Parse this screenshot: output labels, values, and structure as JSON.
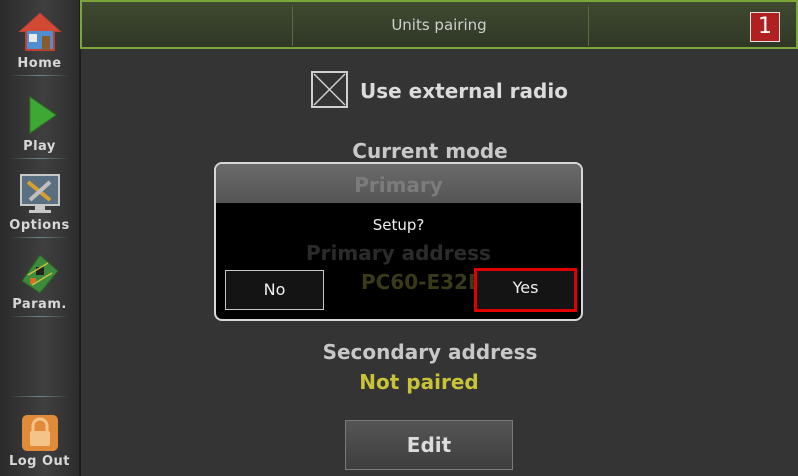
{
  "sidebar": {
    "items": [
      {
        "label": "Home",
        "icon": "house-icon"
      },
      {
        "label": "Play",
        "icon": "play-icon"
      },
      {
        "label": "Options",
        "icon": "tools-monitor-icon"
      },
      {
        "label": "Param.",
        "icon": "circuit-board-icon"
      },
      {
        "label": "Log Out",
        "icon": "padlock-icon"
      }
    ]
  },
  "header": {
    "title": "Units pairing",
    "badge": "1"
  },
  "main": {
    "use_external_radio": {
      "label": "Use external radio",
      "checked": true
    },
    "current_mode": {
      "title": "Current mode",
      "value": "Primary"
    },
    "primary_address": {
      "title": "Primary address",
      "value": "PC60-E32E"
    },
    "secondary_address": {
      "title": "Secondary address",
      "value": "Not paired"
    },
    "edit_label": "Edit"
  },
  "dialog": {
    "message": "Setup?",
    "no_label": "No",
    "yes_label": "Yes"
  },
  "colors": {
    "header_border": "#7aa63a",
    "status_value": "#c9c33a",
    "highlight": "#e00000",
    "badge": "#b02020"
  }
}
